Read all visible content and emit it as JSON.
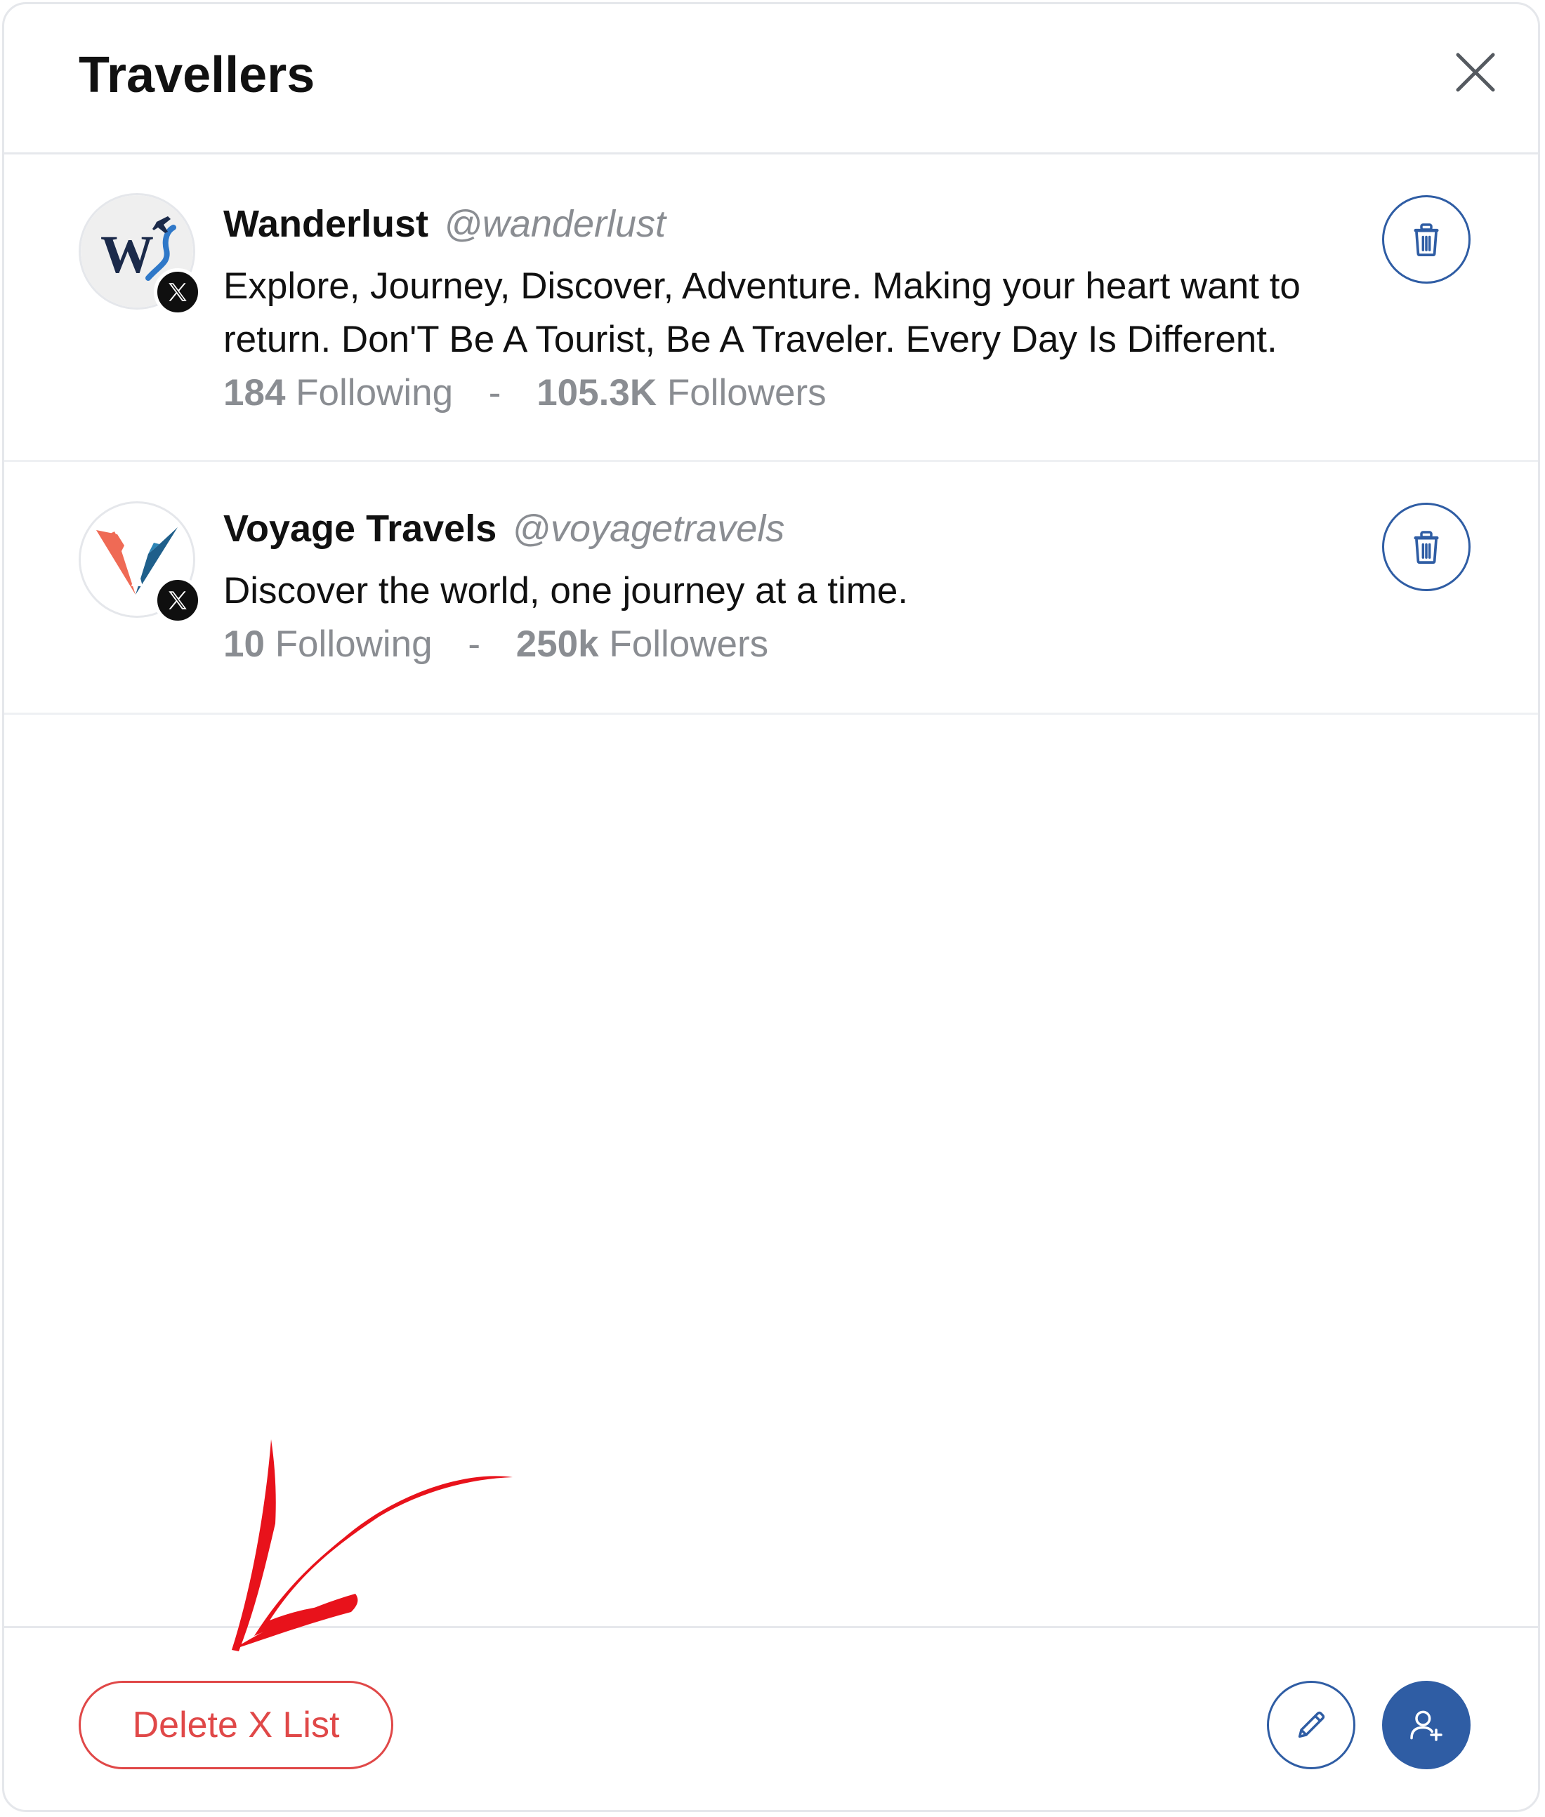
{
  "header": {
    "title": "Travellers"
  },
  "members": [
    {
      "name": "Wanderlust",
      "handle": "@wanderlust",
      "bio": "Explore, Journey, Discover, Adventure. Making your heart want to return. Don'T Be A Tourist, Be A Traveler. Every Day Is Different.",
      "following_count": "184",
      "following_label": "Following",
      "separator": "-",
      "followers_count": "105.3K",
      "followers_label": "Followers",
      "platform": "x-icon"
    },
    {
      "name": "Voyage Travels",
      "handle": "@voyagetravels",
      "bio": "Discover the world, one journey at a time.",
      "following_count": "10",
      "following_label": "Following",
      "separator": "-",
      "followers_count": "250k",
      "followers_label": "Followers",
      "platform": "x-icon"
    }
  ],
  "footer": {
    "delete_list_label": "Delete X List",
    "edit_icon": "pencil-icon",
    "add_member_icon": "user-plus-icon"
  },
  "colors": {
    "accent_blue": "#2f5da4",
    "danger_red": "#e04848",
    "annotation_red": "#e8121b",
    "muted_text": "#8a8d92"
  },
  "annotation": {
    "type": "hand-drawn-arrow",
    "points_to": "delete-x-list-button"
  }
}
